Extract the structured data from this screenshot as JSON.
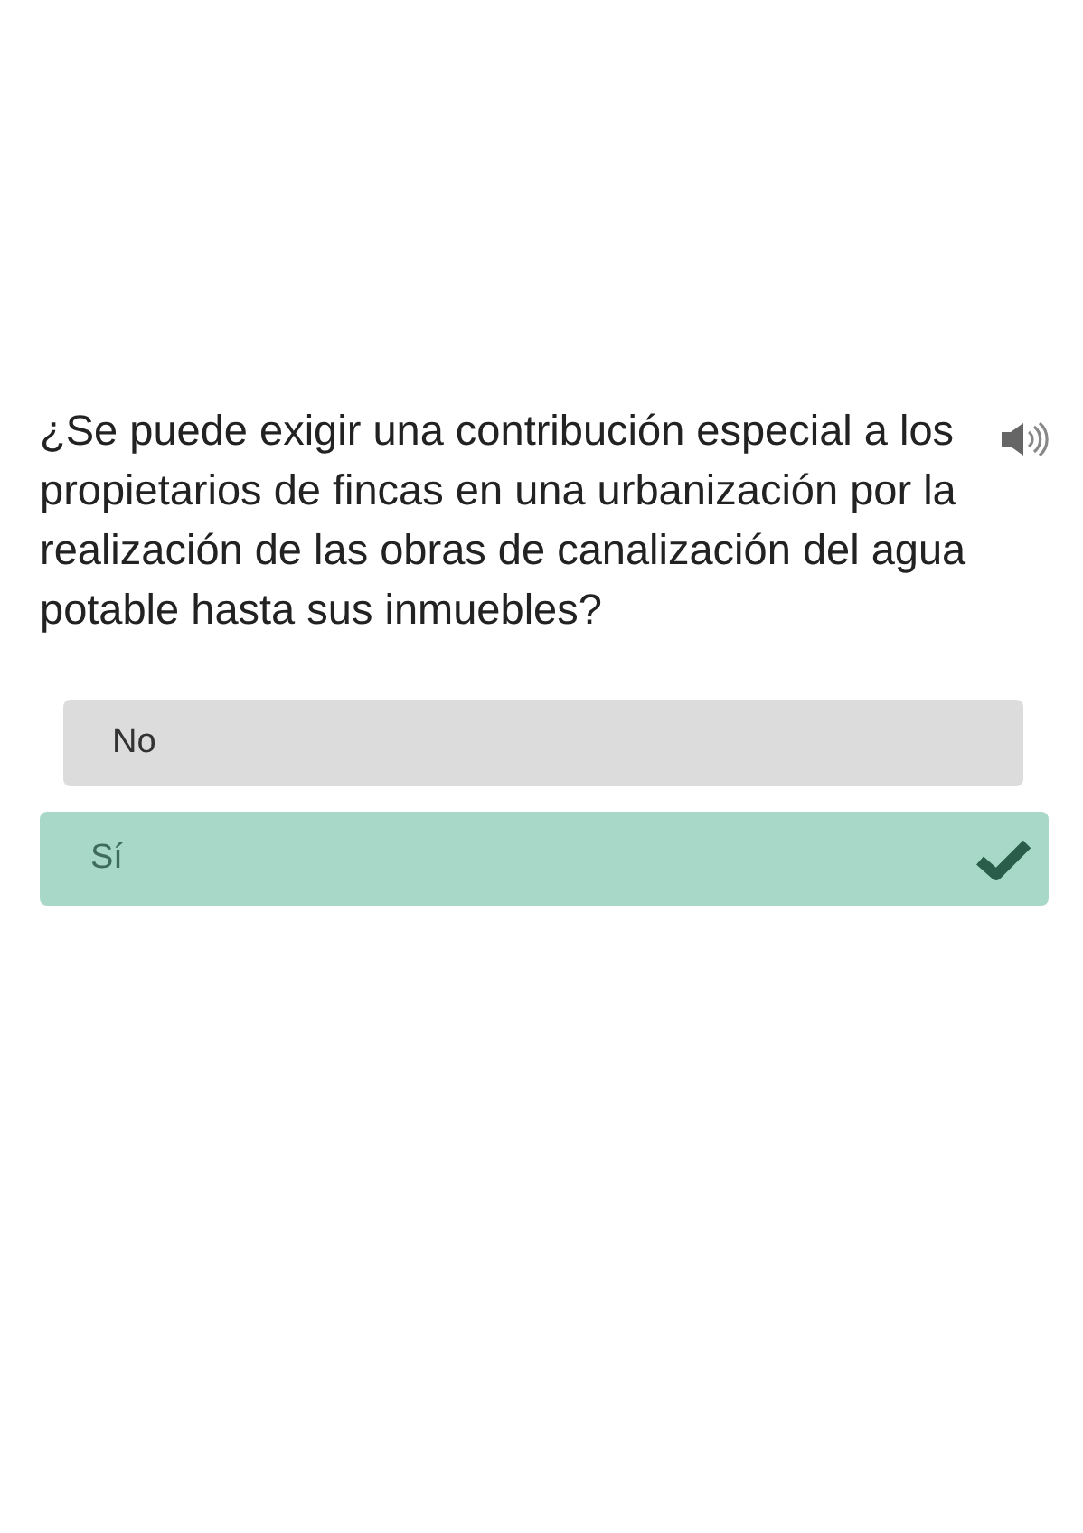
{
  "question": "¿Se puede exigir una contribución especial a los propietarios de fincas en una urbanización por la realización de las obras de canalización del agua potable hasta sus inmuebles?",
  "options": [
    {
      "label": "No",
      "selected": false
    },
    {
      "label": "Sí",
      "selected": true
    }
  ]
}
